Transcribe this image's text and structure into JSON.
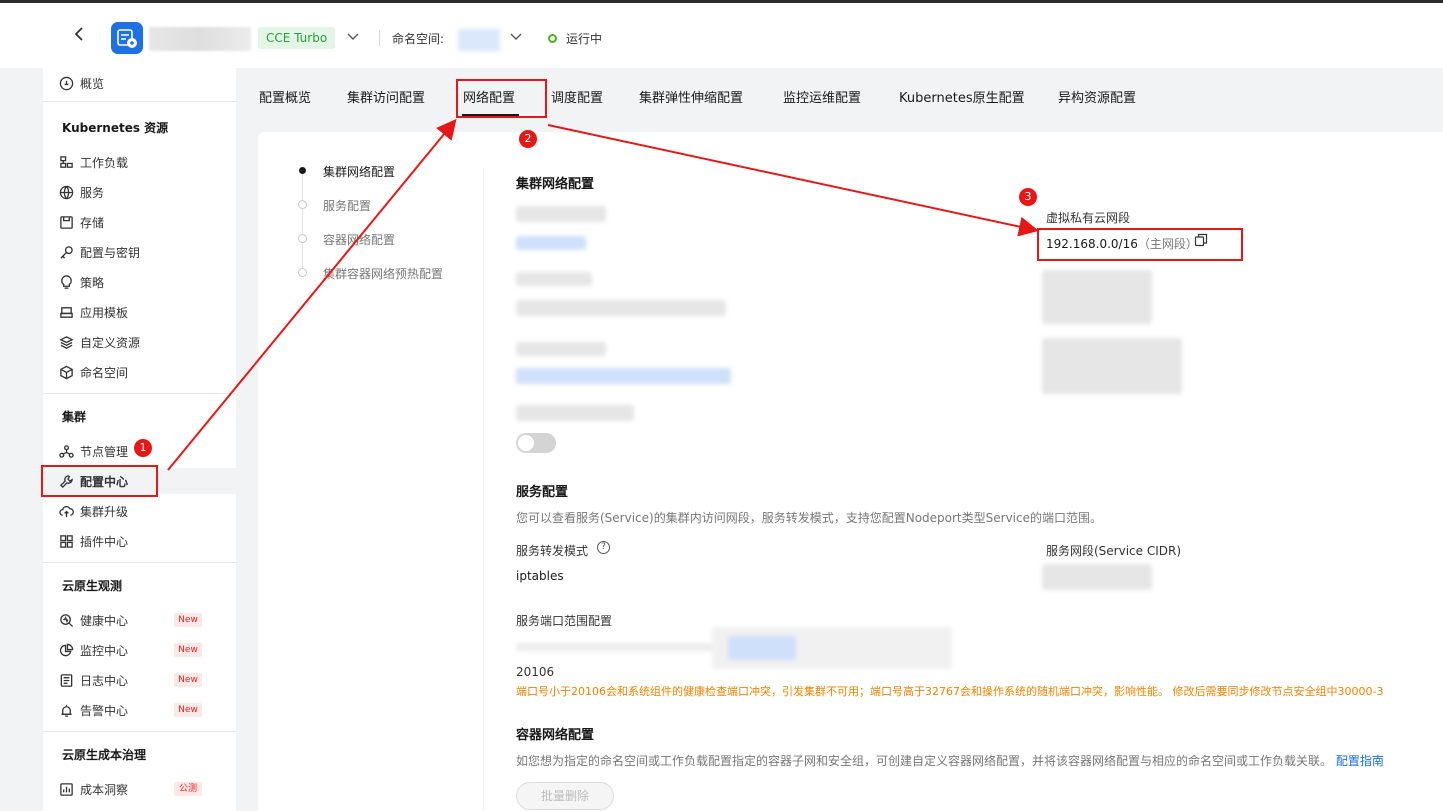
{
  "header": {
    "cluster_tag": "CCE Turbo",
    "namespace_label": "命名空间:",
    "status": "运行中"
  },
  "sidebar": {
    "overview": "概览",
    "group_k8s": "Kubernetes 资源",
    "k8s_items": [
      "工作负载",
      "服务",
      "存储",
      "配置与密钥",
      "策略",
      "应用模板",
      "自定义资源",
      "命名空间"
    ],
    "group_cluster": "集群",
    "cluster_items": [
      "节点管理",
      "配置中心",
      "集群升级",
      "插件中心"
    ],
    "group_observe": "云原生观测",
    "observe_items": [
      "健康中心",
      "监控中心",
      "日志中心",
      "告警中心"
    ],
    "badge_new": "New",
    "group_cost": "云原生成本治理",
    "cost_items": [
      "成本洞察"
    ],
    "badge_beta": "公测"
  },
  "tabs": [
    "配置概览",
    "集群访问配置",
    "网络配置",
    "调度配置",
    "集群弹性伸缩配置",
    "监控运维配置",
    "Kubernetes原生配置",
    "异构资源配置"
  ],
  "anchors": [
    "集群网络配置",
    "服务配置",
    "容器网络配置",
    "集群容器网络预热配置"
  ],
  "network": {
    "title": "集群网络配置",
    "vpc_label": "虚拟私有云网段",
    "vpc_cidr": "192.168.0.0/16",
    "vpc_primary": "（主网段）"
  },
  "service": {
    "title": "服务配置",
    "desc": "您可以查看服务(Service)的集群内访问网段，服务转发模式，支持您配置Nodeport类型Service的端口范围。",
    "forward_label": "服务转发模式",
    "forward_value": "iptables",
    "cidr_label": "服务网段(Service CIDR)",
    "port_range_label": "服务端口范围配置",
    "port_value": "20106",
    "warning": "端口号小于20106会和系统组件的健康检查端口冲突，引发集群不可用；端口号高于32767会和操作系统的随机端口冲突，影响性能。 修改后需要同步修改节点安全组中30000-3"
  },
  "container_network": {
    "title": "容器网络配置",
    "desc": "如您想为指定的命名空间或工作负载配置指定的容器子网和安全组，可创建自定义容器网络配置，并将该容器网络配置与相应的命名空间或工作负载关联。",
    "guide_link": "配置指南",
    "batch_delete": "批量删除"
  },
  "annotations": [
    "1",
    "2",
    "3"
  ],
  "colors": {
    "highlight": "#e61717",
    "primary": "#1a6ee8",
    "warning": "#f08300",
    "turbo_tag": "#2c9a3d"
  }
}
